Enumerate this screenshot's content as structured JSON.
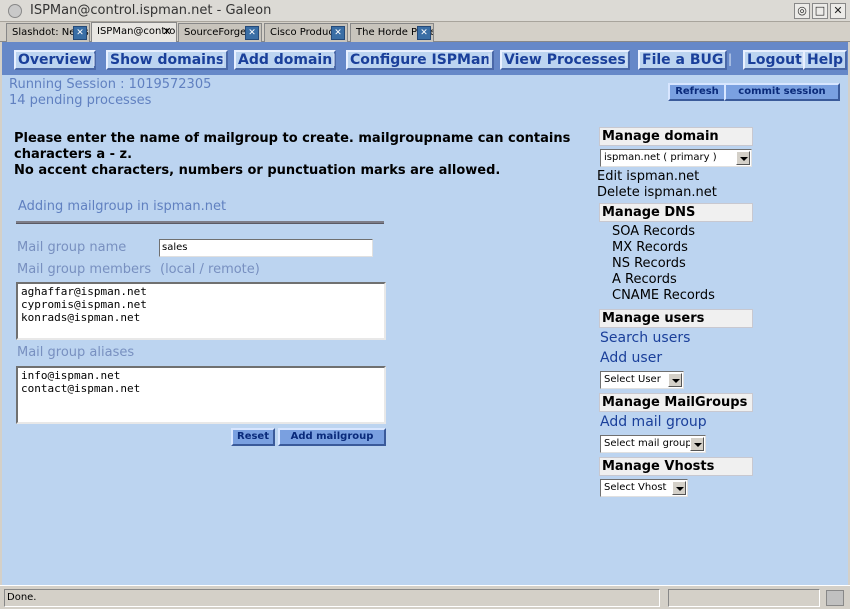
{
  "window": {
    "title": "ISPMan@control.ispman.net - Galeon",
    "controls": {
      "minimize": "◎",
      "maximize": "□",
      "close": "✕"
    }
  },
  "tabs": [
    {
      "label": "Slashdot: News",
      "active": false
    },
    {
      "label": "ISPMan@control.ispman.net",
      "active": true
    },
    {
      "label": "SourceForge",
      "active": false
    },
    {
      "label": "Cisco Products",
      "active": false
    },
    {
      "label": "The Horde Project",
      "active": false
    }
  ],
  "tab_close_glyph": "✕",
  "nav": {
    "items": [
      "Overview",
      "Show domains",
      "Add domain",
      "Configure ISPMan",
      "View Processes",
      "File a BUG",
      "Logout",
      "Help"
    ],
    "separator": "|"
  },
  "session": {
    "running": "Running Session : 1019572305",
    "pending": "14 pending processes"
  },
  "top_buttons": {
    "refresh": "Refresh",
    "commit": "commit session"
  },
  "instructions": {
    "line1": "Please enter the name of mailgroup to create. mailgroupname can contains characters a - z.",
    "line2": "No accent characters, numbers or punctuation marks are allowed."
  },
  "form": {
    "title": "Adding mailgroup in ispman.net",
    "name_label": "Mail group name",
    "name_value": "sales",
    "members_label": "Mail group members",
    "members_hint": "(local / remote)",
    "members": [
      "aghaffar@ispman.net",
      "cypromis@ispman.net",
      "konrads@ispman.net"
    ],
    "aliases_label": "Mail group aliases",
    "aliases": [
      "info@ispman.net",
      "contact@ispman.net"
    ],
    "reset_label": "Reset",
    "submit_label": "Add mailgroup"
  },
  "sidebar": {
    "manage_domain": {
      "heading": "Manage domain",
      "select": "ispman.net ( primary )",
      "links": [
        "Edit ispman.net",
        "Delete ispman.net"
      ]
    },
    "manage_dns": {
      "heading": "Manage DNS",
      "links": [
        "SOA Records",
        "MX Records",
        "NS Records",
        "A Records",
        "CNAME Records"
      ]
    },
    "manage_users": {
      "heading": "Manage users",
      "links": [
        "Search users",
        "Add user"
      ],
      "select": "Select User"
    },
    "manage_mailgroups": {
      "heading": "Manage MailGroups",
      "links": [
        "Add mail group"
      ],
      "select": "Select mail group"
    },
    "manage_vhosts": {
      "heading": "Manage Vhosts",
      "select": "Select Vhost"
    }
  },
  "status": {
    "text": "Done."
  },
  "colors": {
    "page_bg": "#bcd4f0",
    "nav_bg": "#6688c8",
    "nav_text": "#1a3f9a",
    "label_text": "#7890c0"
  }
}
